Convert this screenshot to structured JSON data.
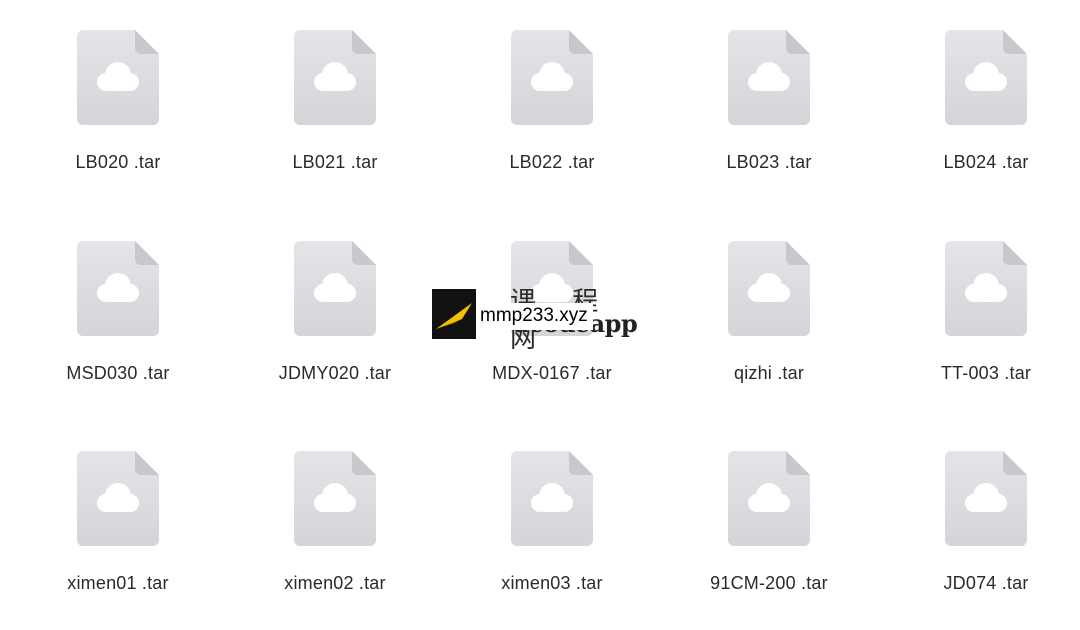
{
  "files": [
    {
      "name": "LB020 .tar",
      "icon": "cloud-file-icon"
    },
    {
      "name": "LB021 .tar",
      "icon": "cloud-file-icon"
    },
    {
      "name": "LB022 .tar",
      "icon": "cloud-file-icon"
    },
    {
      "name": "LB023 .tar",
      "icon": "cloud-file-icon"
    },
    {
      "name": "LB024 .tar",
      "icon": "cloud-file-icon"
    },
    {
      "name": "MSD030 .tar",
      "icon": "cloud-file-icon"
    },
    {
      "name": "JDMY020 .tar",
      "icon": "cloud-file-icon"
    },
    {
      "name": "MDX-0167 .tar",
      "icon": "cloud-file-icon"
    },
    {
      "name": "qizhi .tar",
      "icon": "cloud-file-icon"
    },
    {
      "name": "TT-003 .tar",
      "icon": "cloud-file-icon"
    },
    {
      "name": "ximen01 .tar",
      "icon": "cloud-file-icon"
    },
    {
      "name": "ximen02 .tar",
      "icon": "cloud-file-icon"
    },
    {
      "name": "ximen03 .tar",
      "icon": "cloud-file-icon"
    },
    {
      "name": "91CM-200 .tar",
      "icon": "cloud-file-icon"
    },
    {
      "name": "JD074 .tar",
      "icon": "cloud-file-icon"
    }
  ],
  "watermark": {
    "chinese_text": "课 程 网",
    "english_text": "ucodeapp",
    "url_text": "mmp233.xyz"
  },
  "colors": {
    "file_icon_fill": "#dcdee2",
    "cloud_fill": "#ffffff",
    "label_text": "#2a2a2a",
    "background": "#ffffff"
  }
}
